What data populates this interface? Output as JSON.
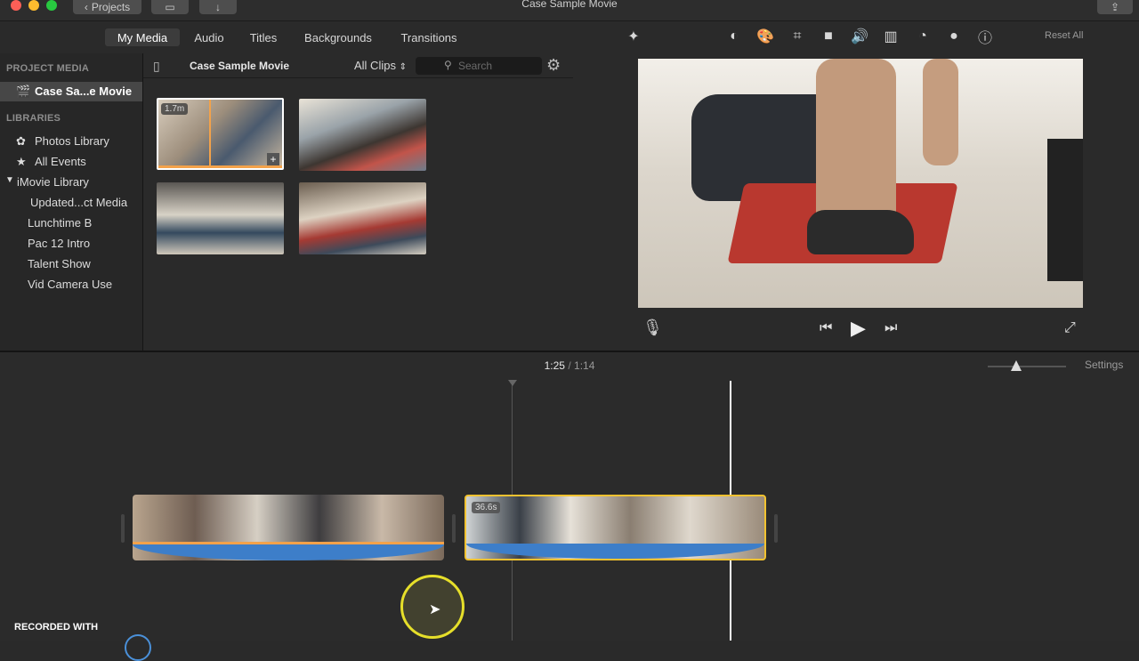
{
  "window": {
    "title": "Case Sample Movie",
    "projects_button": "Projects"
  },
  "tabs": [
    "My Media",
    "Audio",
    "Titles",
    "Backgrounds",
    "Transitions"
  ],
  "toolbar": {
    "reset_all": "Reset All"
  },
  "sidebar": {
    "project_media_heading": "PROJECT MEDIA",
    "project_item": "Case Sa...e Movie",
    "libraries_heading": "LIBRARIES",
    "photos_library": "Photos Library",
    "all_events": "All Events",
    "imovie_library": "iMovie Library",
    "events": [
      "Updated...ct Media",
      "Lunchtime B",
      "Pac 12 Intro",
      "Talent Show",
      "Vid Camera Use"
    ]
  },
  "browser": {
    "title": "Case Sample Movie",
    "filter": "All Clips",
    "search_placeholder": "Search",
    "first_clip_duration": "1.7m"
  },
  "timeline": {
    "current_time": "1:25",
    "separator": "/",
    "total_time": "1:14",
    "settings_label": "Settings",
    "selected_clip_duration": "36.6s"
  },
  "watermark": "RECORDED WITH",
  "colors": {
    "accent_yellow": "#f2c230",
    "audio_blue": "#3d7ec9",
    "playhead": "#ffffff"
  }
}
